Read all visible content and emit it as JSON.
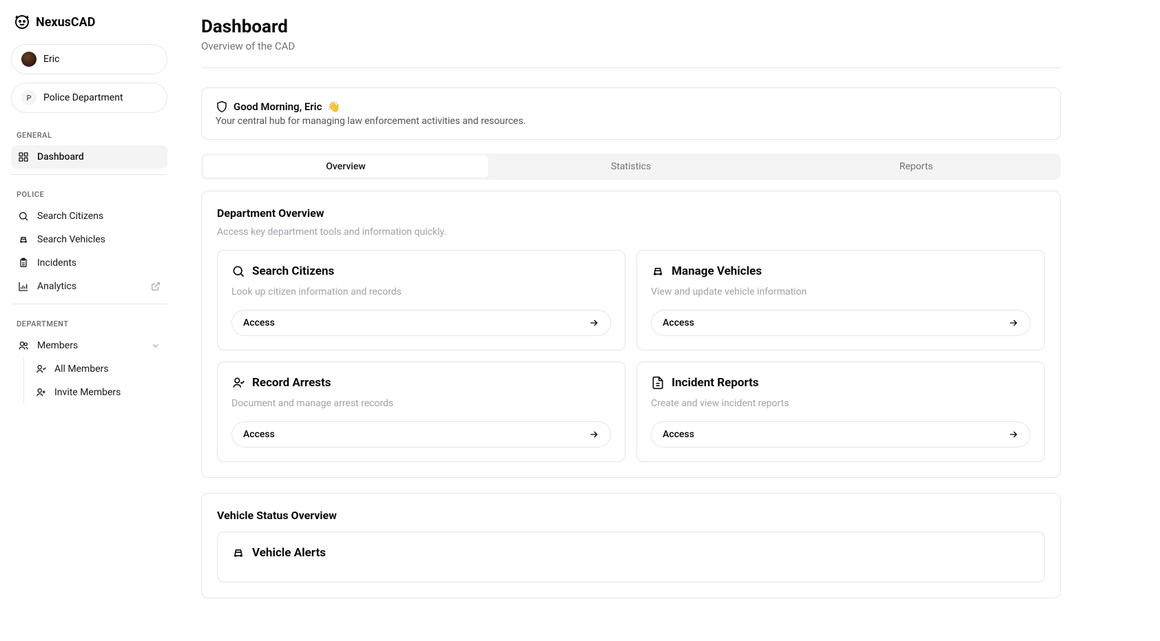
{
  "app_name": "NexusCAD",
  "user": {
    "name": "Eric"
  },
  "department": {
    "letter": "P",
    "name": "Police Department"
  },
  "sections": {
    "general": "GENERAL",
    "police": "POLICE",
    "department": "DEPARTMENT"
  },
  "nav": {
    "dashboard": "Dashboard",
    "search_citizens": "Search Citizens",
    "search_vehicles": "Search Vehicles",
    "incidents": "Incidents",
    "analytics": "Analytics",
    "members": "Members",
    "all_members": "All Members",
    "invite_members": "Invite Members"
  },
  "page": {
    "title": "Dashboard",
    "subtitle": "Overview of the CAD"
  },
  "greeting": {
    "title": "Good Morning, Eric",
    "emoji": "👋",
    "subtitle": "Your central hub for managing law enforcement activities and resources."
  },
  "tabs": {
    "overview": "Overview",
    "statistics": "Statistics",
    "reports": "Reports"
  },
  "dept_overview": {
    "title": "Department Overview",
    "subtitle": "Access key department tools and information quickly."
  },
  "cards": {
    "search_citizens": {
      "title": "Search Citizens",
      "desc": "Look up citizen information and records",
      "button": "Access"
    },
    "manage_vehicles": {
      "title": "Manage Vehicles",
      "desc": "View and update vehicle information",
      "button": "Access"
    },
    "record_arrests": {
      "title": "Record Arrests",
      "desc": "Document and manage arrest records",
      "button": "Access"
    },
    "incident_reports": {
      "title": "Incident Reports",
      "desc": "Create and view incident reports",
      "button": "Access"
    }
  },
  "vehicle_status": {
    "title": "Vehicle Status Overview",
    "alerts_title": "Vehicle Alerts"
  }
}
